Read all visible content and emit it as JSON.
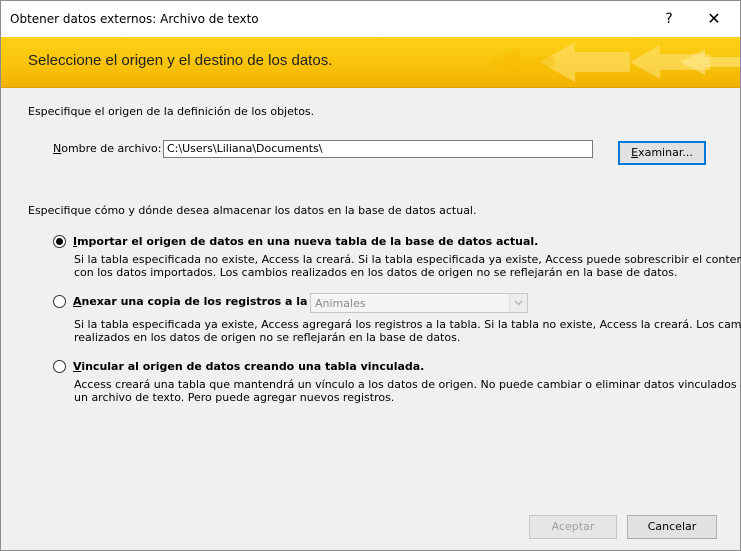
{
  "window": {
    "title": "Obtener datos externos: Archivo de texto",
    "help_label": "?",
    "close_label": "✕"
  },
  "banner": {
    "heading": "Seleccione el origen y el destino de los datos."
  },
  "source": {
    "intro": "Especifique el origen de la definición de los objetos.",
    "filename_label_underlined": "N",
    "filename_label_rest": "ombre de archivo:",
    "filename_value": "C:\\Users\\Liliana\\Documents\\",
    "browse_underlined": "E",
    "browse_rest": "xaminar..."
  },
  "destination": {
    "intro": "Especifique cómo y dónde desea almacenar los datos en la base de datos actual.",
    "options": [
      {
        "title_underlined": "I",
        "title_rest": "mportar el origen de datos en una nueva tabla de la base de datos actual.",
        "desc_line1": "Si la tabla especificada no existe, Access la creará. Si la tabla especificada ya existe, Access puede sobrescribir el contenido",
        "desc_line2": "con los datos importados. Los cambios realizados en los datos de origen no se reflejarán en la base de datos.",
        "checked": true
      },
      {
        "title_underlined": "A",
        "title_rest": "nexar una copia de los registros a la tabla:",
        "combo_value": "Animales",
        "desc_line1": "Si la tabla especificada ya existe, Access agregará los registros a la tabla. Si la tabla no existe, Access la creará. Los cambios",
        "desc_line2": "realizados en los datos de origen no se reflejarán en la base de datos.",
        "checked": false
      },
      {
        "title_underlined": "V",
        "title_rest": "incular al origen de datos creando una tabla vinculada.",
        "desc_line1": "Access creará una tabla que mantendrá un vínculo a los datos de origen. No puede cambiar o eliminar datos vinculados a",
        "desc_line2": "un archivo de texto. Pero puede agregar nuevos registros.",
        "checked": false
      }
    ]
  },
  "footer": {
    "ok_label": "Aceptar",
    "cancel_label": "Cancelar"
  },
  "colors": {
    "banner_gold": "#f9c30a",
    "focus_blue": "#0078d7"
  }
}
